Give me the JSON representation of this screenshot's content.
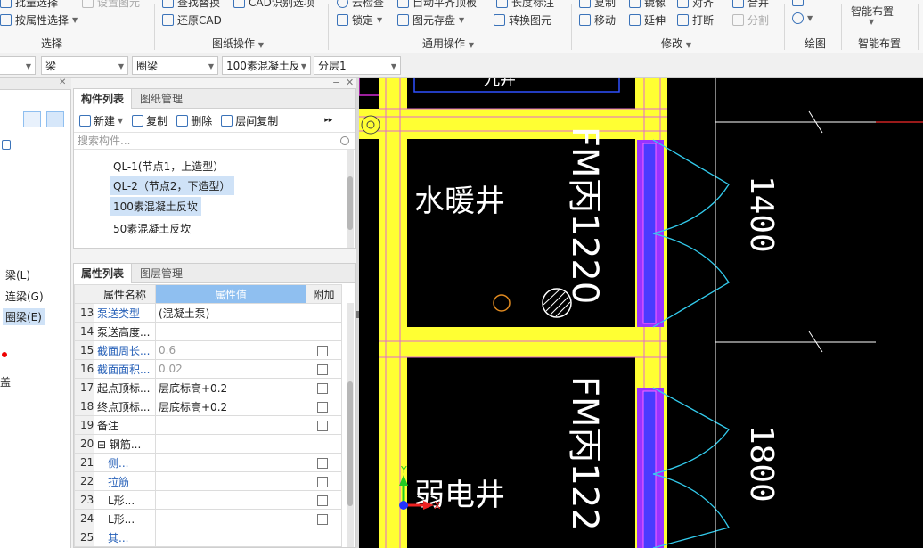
{
  "ribbon": {
    "items": [
      {
        "label": "批量选择",
        "icon": "batch-select-icon",
        "dim": false
      },
      {
        "label": "按属性选择",
        "icon": "select-by-property-icon",
        "dim": false
      },
      {
        "label": "设置图元",
        "icon": "set-element-icon",
        "dim": true
      },
      {
        "label": "查找替换",
        "icon": "find-replace-icon",
        "dim": false
      },
      {
        "label": "还原CAD",
        "icon": "restore-cad-icon",
        "dim": false
      },
      {
        "label": "CAD识别选项",
        "icon": "cad-recognize-options-icon",
        "dim": false
      },
      {
        "label": "云检查",
        "icon": "cloud-check-icon",
        "dim": false
      },
      {
        "label": "锁定",
        "icon": "lock-icon",
        "dim": false
      },
      {
        "label": "自动平齐顶板",
        "icon": "auto-align-top-icon",
        "dim": false
      },
      {
        "label": "图元存盘",
        "icon": "element-save-icon",
        "dim": false
      },
      {
        "label": "长度标注",
        "icon": "length-dimension-icon",
        "dim": false
      },
      {
        "label": "转换图元",
        "icon": "convert-element-icon",
        "dim": false
      },
      {
        "label": "复制",
        "icon": "copy-icon",
        "dim": false
      },
      {
        "label": "移动",
        "icon": "move-icon",
        "dim": false
      },
      {
        "label": "镜像",
        "icon": "mirror-icon",
        "dim": false
      },
      {
        "label": "延伸",
        "icon": "extend-icon",
        "dim": false
      },
      {
        "label": "对齐",
        "icon": "align-icon",
        "dim": false
      },
      {
        "label": "打断",
        "icon": "break-icon",
        "dim": false
      },
      {
        "label": "合并",
        "icon": "merge-icon",
        "dim": false
      },
      {
        "label": "分割",
        "icon": "split-icon",
        "dim": true
      },
      {
        "label": "智能布置",
        "icon": "smart-layout-icon",
        "dim": false
      }
    ],
    "groups": [
      "选择",
      "图纸操作",
      "通用操作",
      "修改",
      "绘图",
      "智能布置"
    ]
  },
  "selectors": [
    {
      "value": "",
      "name": "floor-selector"
    },
    {
      "value": "梁",
      "name": "type-selector"
    },
    {
      "value": "圈梁",
      "name": "subtype-selector"
    },
    {
      "value": "100素混凝土反",
      "name": "component-selector"
    },
    {
      "value": "分层1",
      "name": "layer-selector"
    }
  ],
  "left_nav": {
    "items": [
      "梁(L)",
      "连梁(G)",
      "圈梁(E)",
      "盖"
    ],
    "selected": "圈梁(E)"
  },
  "component_panel": {
    "tabs": [
      "构件列表",
      "图纸管理"
    ],
    "toolbar": [
      "新建",
      "复制",
      "删除",
      "层间复制"
    ],
    "search_placeholder": "搜索构件...",
    "items": [
      "QL-1(节点1，上造型）",
      "QL-2（节点2，下造型）",
      "100素混凝土反坎",
      "50素混凝土反坎"
    ],
    "selected": "100素混凝土反坎"
  },
  "property_panel": {
    "tabs": [
      "属性列表",
      "图层管理"
    ],
    "headers": [
      "属性名称",
      "属性值",
      "附加"
    ],
    "rows": [
      {
        "no": "13",
        "name": "泵送类型",
        "value": "(混凝土泵)",
        "check": false,
        "blue": true,
        "grey": false
      },
      {
        "no": "14",
        "name": "泵送高度...",
        "value": "",
        "check": false,
        "blue": false,
        "grey": false
      },
      {
        "no": "15",
        "name": "截面周长...",
        "value": "0.6",
        "check": true,
        "blue": true,
        "grey": true
      },
      {
        "no": "16",
        "name": "截面面积...",
        "value": "0.02",
        "check": true,
        "blue": true,
        "grey": true
      },
      {
        "no": "17",
        "name": "起点顶标...",
        "value": "层底标高+0.2",
        "check": true,
        "blue": false,
        "grey": false
      },
      {
        "no": "18",
        "name": "终点顶标...",
        "value": "层底标高+0.2",
        "check": true,
        "blue": false,
        "grey": false
      },
      {
        "no": "19",
        "name": "备注",
        "value": "",
        "check": true,
        "blue": false,
        "grey": false
      },
      {
        "no": "20",
        "name": "⊟ 钢筋...",
        "value": "",
        "check": false,
        "blue": false,
        "grey": false
      },
      {
        "no": "21",
        "name": "　侧...",
        "value": "",
        "check": true,
        "blue": true,
        "grey": false
      },
      {
        "no": "22",
        "name": "　拉筋",
        "value": "",
        "check": true,
        "blue": true,
        "grey": false
      },
      {
        "no": "23",
        "name": "　L形...",
        "value": "",
        "check": true,
        "blue": false,
        "grey": false
      },
      {
        "no": "24",
        "name": "　L形...",
        "value": "",
        "check": true,
        "blue": false,
        "grey": false
      },
      {
        "no": "25",
        "name": "　其...",
        "value": "",
        "check": false,
        "blue": true,
        "grey": false
      }
    ]
  },
  "canvas": {
    "text_water": "水暖井",
    "text_elec": "弱电井",
    "door_1": "FM丙1220",
    "door_2": "FM丙122",
    "dim_1": "1400",
    "dim_2": "1800",
    "axis_x": "X",
    "axis_y": "Y",
    "colors": {
      "wall": "#ffff33",
      "door": "#9933ff",
      "arc": "#33ccee",
      "text": "#ffffff"
    }
  }
}
